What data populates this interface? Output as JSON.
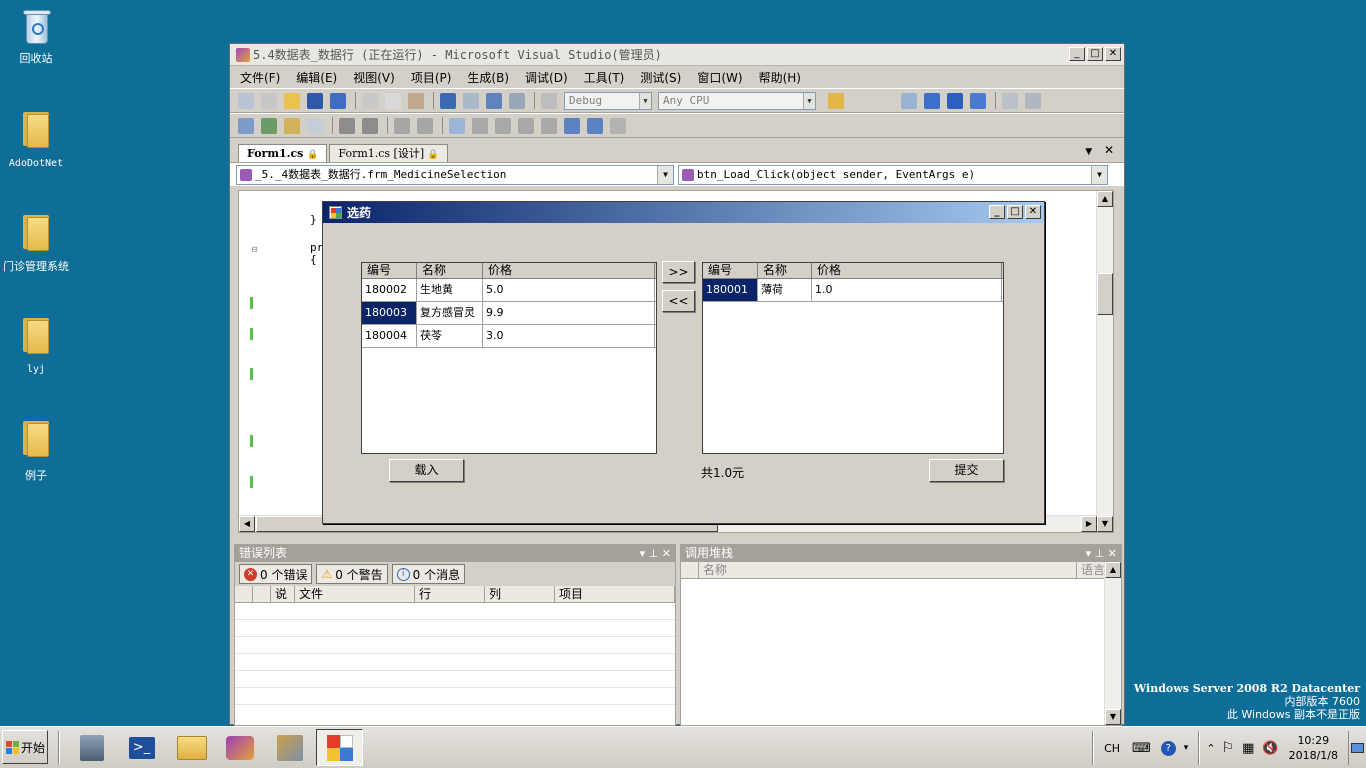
{
  "desktop": {
    "icons": [
      {
        "label": "回收站",
        "kind": "recycle-bin"
      },
      {
        "label": "AdoDotNet",
        "kind": "folder"
      },
      {
        "label": "门诊管理系统",
        "kind": "folder"
      },
      {
        "label": "lyj",
        "kind": "folder"
      },
      {
        "label": "例子",
        "kind": "folder"
      }
    ],
    "watermark": {
      "line1": "Windows Server 2008 R2 Datacenter",
      "line2": "内部版本 7600",
      "line3": "此 Windows 副本不是正版"
    }
  },
  "vs": {
    "title": "5.4数据表_数据行 (正在运行) - Microsoft Visual Studio(管理员)",
    "menu": [
      "文件(F)",
      "编辑(E)",
      "视图(V)",
      "项目(P)",
      "生成(B)",
      "调试(D)",
      "工具(T)",
      "测试(S)",
      "窗口(W)",
      "帮助(H)"
    ],
    "config_combo": "Debug",
    "platform_combo": "Any CPU",
    "doc_tabs": [
      {
        "label": "Form1.cs",
        "active": true
      },
      {
        "label": "Form1.cs [设计]",
        "active": false
      }
    ],
    "nav": {
      "type_combo": "_5._4数据表_数据行.frm_MedicineSelection",
      "member_combo": "btn_Load_Click(object sender, EventArgs e)"
    },
    "code_lines": [
      "}",
      "pr",
      "{"
    ]
  },
  "form": {
    "title": "选药",
    "left_grid": {
      "headers": [
        "编号",
        "名称",
        "价格"
      ],
      "rows": [
        [
          "180002",
          "生地黄",
          "5.0"
        ],
        [
          "180003",
          "复方感冒灵",
          "9.9"
        ],
        [
          "180004",
          "茯苓",
          "3.0"
        ]
      ],
      "selected_row": 1
    },
    "right_grid": {
      "headers": [
        "编号",
        "名称",
        "价格"
      ],
      "rows": [
        [
          "180001",
          "薄荷",
          "1.0"
        ]
      ],
      "selected_row": 0
    },
    "move_right_label": ">>",
    "move_left_label": "<<",
    "load_label": "载入",
    "total_label": "共1.0元",
    "submit_label": "提交"
  },
  "error_list": {
    "title": "错误列表",
    "errors_label": "0 个错误",
    "warnings_label": "0 个警告",
    "messages_label": "0 个消息",
    "columns": [
      "",
      "",
      "说",
      "文件",
      "行",
      "列",
      "项目"
    ]
  },
  "call_stack": {
    "title": "调用堆栈",
    "columns": [
      "名称",
      "语言"
    ]
  },
  "taskbar": {
    "start_label": "开始",
    "lang": "CH",
    "time": "10:29",
    "date": "2018/1/8"
  }
}
